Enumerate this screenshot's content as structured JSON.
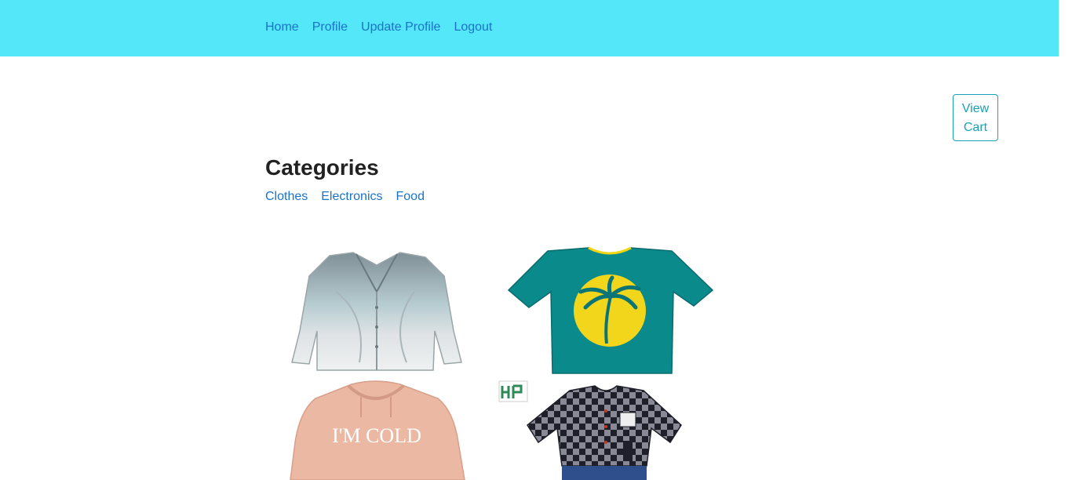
{
  "nav": {
    "items": [
      {
        "label": "Home"
      },
      {
        "label": "Profile"
      },
      {
        "label": "Update Profile"
      },
      {
        "label": "Logout"
      }
    ]
  },
  "cart": {
    "label_line1": "View",
    "label_line2": "Cart"
  },
  "categories": {
    "title": "Categories",
    "items": [
      {
        "label": "Clothes"
      },
      {
        "label": "Electronics"
      },
      {
        "label": "Food"
      }
    ]
  },
  "products": [
    {
      "icon": "grey-button-shirt-image"
    },
    {
      "icon": "teal-palm-tshirt-image"
    },
    {
      "icon": "peach-hoodie-image",
      "print": "I'M COLD"
    },
    {
      "icon": "kids-check-shirt-image"
    }
  ],
  "colors": {
    "navbar_bg": "#54e7fa",
    "link": "#1a73c9",
    "accent": "#17a2b8"
  }
}
